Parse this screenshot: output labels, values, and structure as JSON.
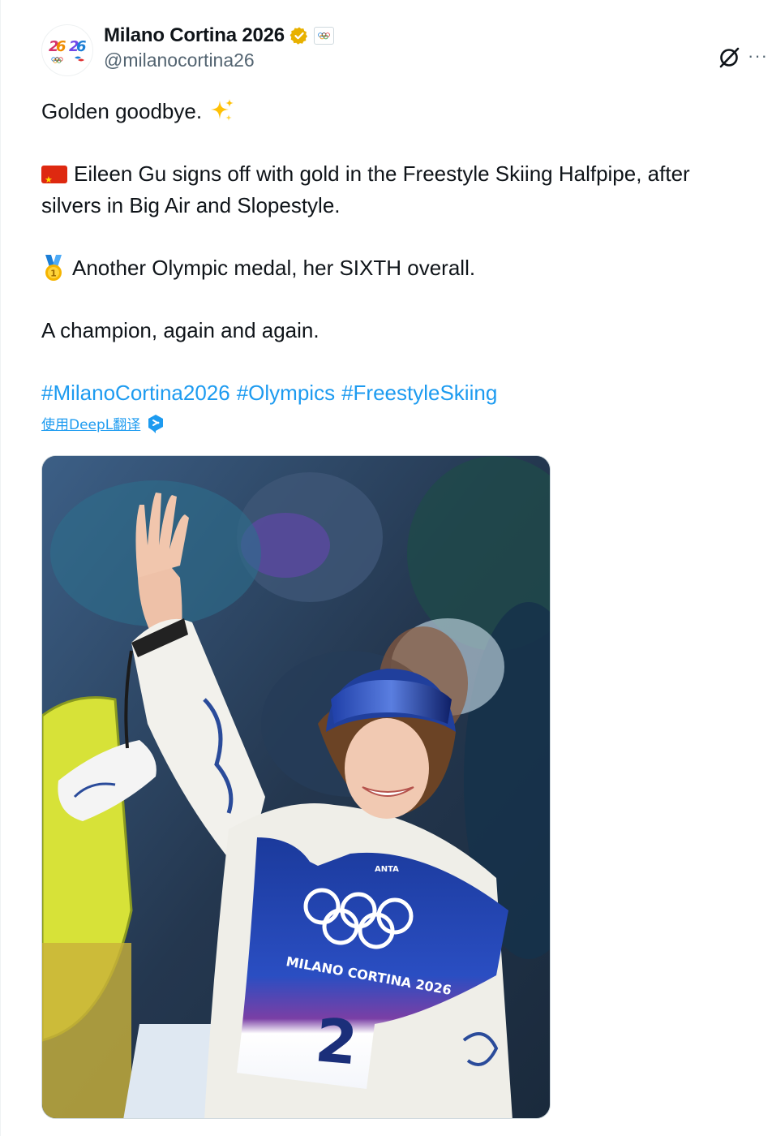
{
  "account": {
    "display_name": "Milano Cortina 2026",
    "handle": "@milanocortina26",
    "avatar_icon": "milano-cortina-logo",
    "verified_color": "#e8b100"
  },
  "header_actions": {
    "grok_icon": "grok-icon",
    "more_icon": "more-icon",
    "more_label": "···"
  },
  "tweet": {
    "line1": "Golden goodbye.",
    "line2": "Eileen Gu signs off with gold in the Freestyle Skiing Halfpipe, after silvers in Big Air and Slopestyle.",
    "line3": "Another Olympic medal, her SIXTH overall.",
    "line4": "A champion, again and again.",
    "hashtags": [
      "#MilanoCortina2026",
      "#Olympics",
      "#FreestyleSkiing"
    ]
  },
  "translate": {
    "label": "使用DeepL翻译"
  },
  "media": {
    "bib_number": "2",
    "bib_text": "MILANO CORTINA 2026",
    "brand": "ANTA"
  },
  "colors": {
    "link": "#1d9bf0",
    "text": "#0f1419",
    "secondary": "#536471"
  }
}
